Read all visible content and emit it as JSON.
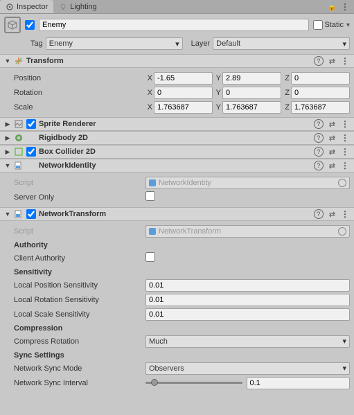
{
  "tabs": {
    "inspector": "Inspector",
    "lighting": "Lighting"
  },
  "gameObject": {
    "name": "Enemy",
    "active": true,
    "static_label": "Static",
    "tag_label": "Tag",
    "tag_value": "Enemy",
    "layer_label": "Layer",
    "layer_value": "Default"
  },
  "transform": {
    "title": "Transform",
    "position_label": "Position",
    "rotation_label": "Rotation",
    "scale_label": "Scale",
    "position": {
      "x": "-1.65",
      "y": "2.89",
      "z": "0"
    },
    "rotation": {
      "x": "0",
      "y": "0",
      "z": "0"
    },
    "scale": {
      "x": "1.763687",
      "y": "1.763687",
      "z": "1.763687"
    }
  },
  "collapsed": {
    "sprite": "Sprite Renderer",
    "rigid": "Rigidbody 2D",
    "box": "Box Collider 2D"
  },
  "networkIdentity": {
    "title": "NetworkIdentity",
    "script_label": "Script",
    "script_value": "NetworkIdentity",
    "server_only_label": "Server Only",
    "server_only": false
  },
  "networkTransform": {
    "title": "NetworkTransform",
    "script_label": "Script",
    "script_value": "NetworkTransform",
    "authority_heading": "Authority",
    "client_authority_label": "Client Authority",
    "client_authority": false,
    "sensitivity_heading": "Sensitivity",
    "local_pos_label": "Local Position Sensitivity",
    "local_pos_val": "0.01",
    "local_rot_label": "Local Rotation Sensitivity",
    "local_rot_val": "0.01",
    "local_scale_label": "Local Scale Sensitivity",
    "local_scale_val": "0.01",
    "compression_heading": "Compression",
    "compress_rot_label": "Compress Rotation",
    "compress_rot_val": "Much",
    "sync_heading": "Sync Settings",
    "sync_mode_label": "Network Sync Mode",
    "sync_mode_val": "Observers",
    "sync_interval_label": "Network Sync Interval",
    "sync_interval_val": "0.1"
  },
  "axes": {
    "x": "X",
    "y": "Y",
    "z": "Z"
  }
}
